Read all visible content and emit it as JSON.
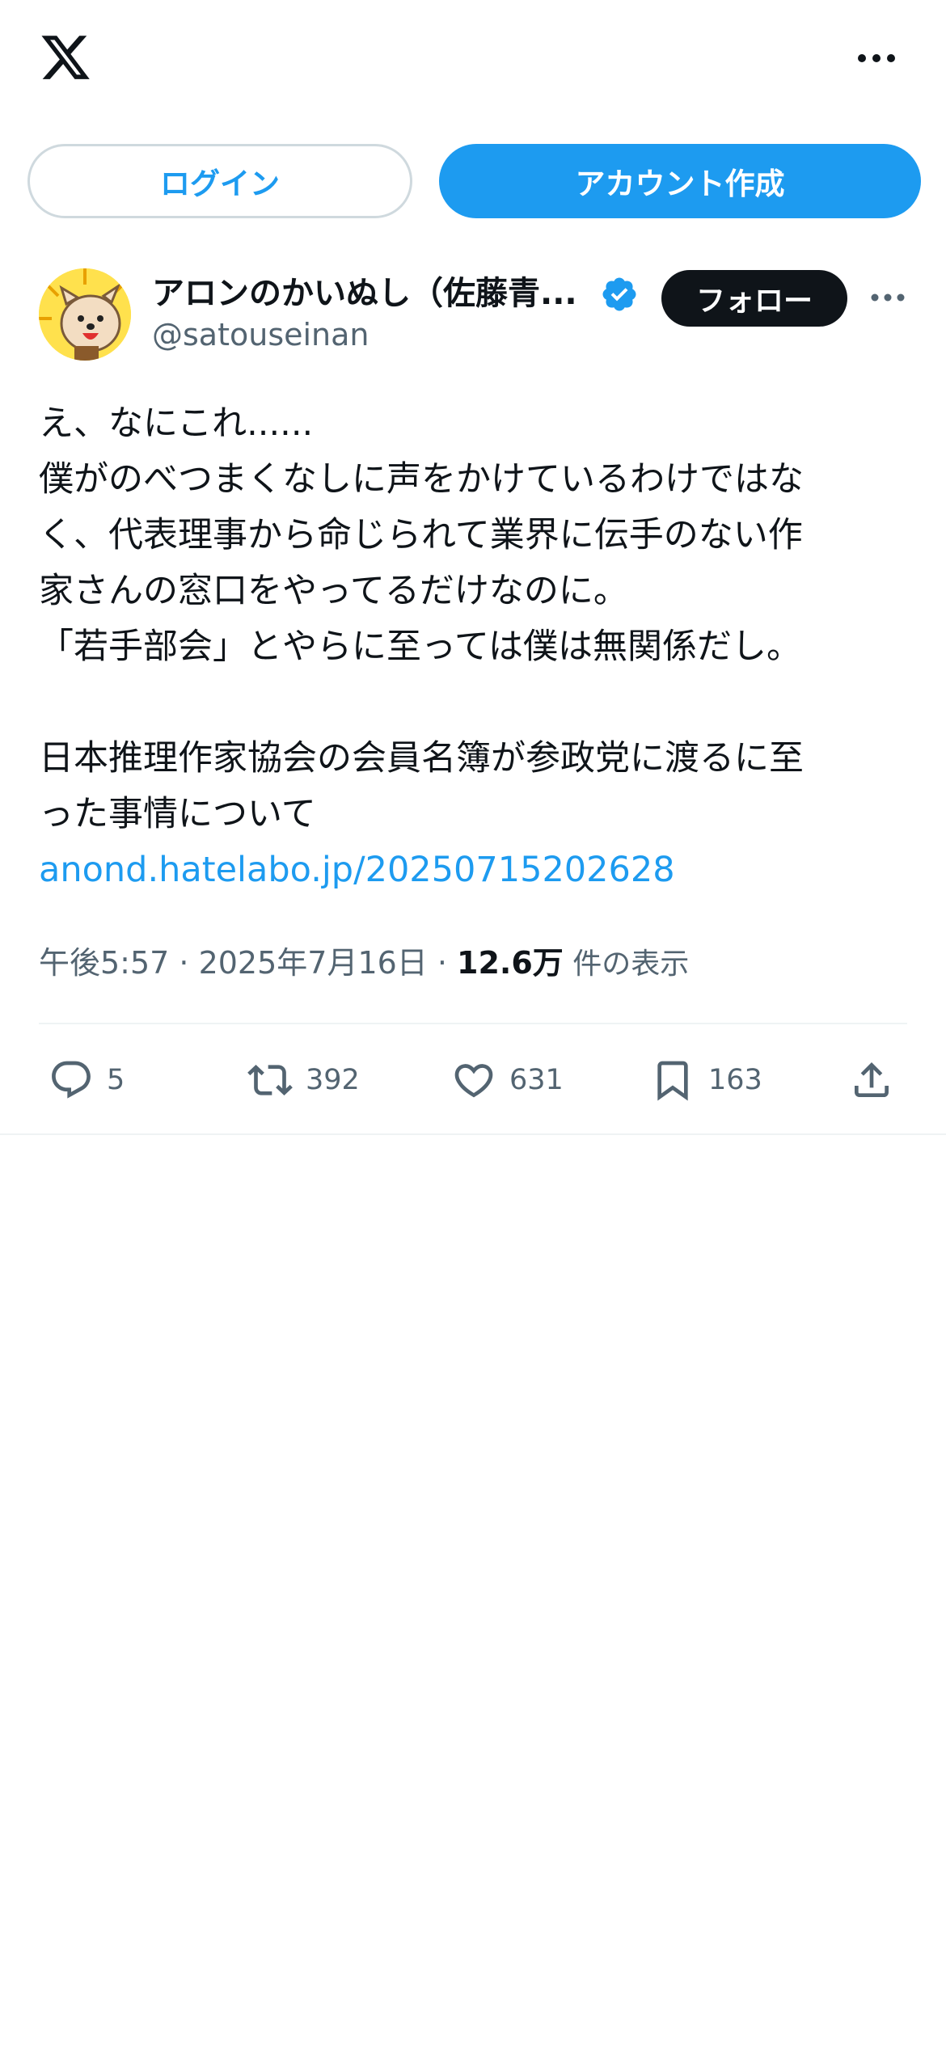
{
  "header": {
    "logo_icon": "x-logo-icon",
    "more_icon": "more-horizontal-icon"
  },
  "auth": {
    "login_label": "ログイン",
    "signup_label": "アカウント作成"
  },
  "author": {
    "display_name": "アロンのかいぬし（佐藤青...",
    "handle": "@satouseinan",
    "verified": true,
    "follow_label": "フォロー"
  },
  "tweet": {
    "lines": [
      "え、なにこれ......",
      "僕がのべつまくなしに声をかけているわけではな",
      "く、代表理事から命じられて業界に伝手のない作",
      "家さんの窓口をやってるだけなのに。",
      "「若手部会」とやらに至っては僕は無関係だし。",
      "",
      "日本推理作家協会の会員名簿が参政党に渡るに至",
      "った事情について"
    ],
    "link": "anond.hatelabo.jp/20250715202628",
    "time": "午後5:57 · 2025年7月16日 · ",
    "views_count": "12.6万",
    "views_label": " 件の表示"
  },
  "actions": {
    "replies": "5",
    "reposts": "392",
    "likes": "631",
    "bookmarks": "163"
  },
  "colors": {
    "accent": "#1d9bf0",
    "text": "#0f1419",
    "secondary": "#536471",
    "border": "#cfd9de"
  }
}
